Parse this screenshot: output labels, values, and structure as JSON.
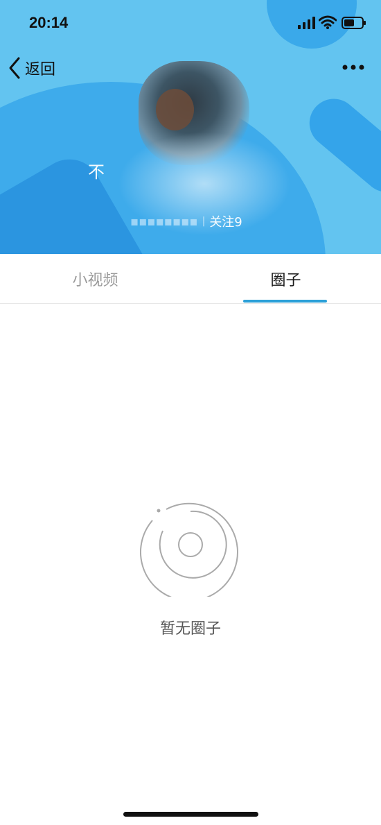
{
  "status_bar": {
    "time": "20:14",
    "icons": [
      "signal-icon",
      "wifi-icon",
      "battery-icon"
    ]
  },
  "nav": {
    "back_label": "返回",
    "back_icon": "chevron-left-icon",
    "more_icon": "more-dots-icon"
  },
  "profile": {
    "cover_text": "不",
    "follow_label": "关注9"
  },
  "tabs": [
    {
      "label": "小视频",
      "active": false
    },
    {
      "label": "圈子",
      "active": true
    }
  ],
  "empty_state": {
    "icon": "empty-circle-icon",
    "message": "暂无圈子"
  },
  "colors": {
    "accent": "#2ca0d8",
    "cover_bg": "#63c4f0"
  }
}
